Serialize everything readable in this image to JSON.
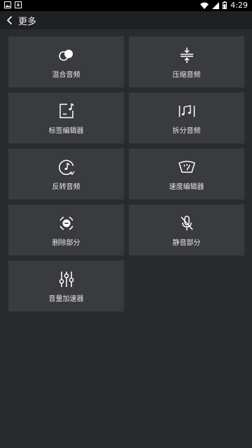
{
  "status_bar": {
    "time": "4:29",
    "icons": [
      "image-notification-icon",
      "download-notification-icon",
      "wifi-icon",
      "signal-icon",
      "battery-icon"
    ]
  },
  "header": {
    "back_icon": "chevron-left-icon",
    "title": "更多"
  },
  "tools": [
    {
      "label": "混合音频",
      "icon": "mix-audio-icon"
    },
    {
      "label": "压缩音频",
      "icon": "compress-audio-icon"
    },
    {
      "label": "标签编辑器",
      "icon": "tag-editor-icon"
    },
    {
      "label": "拆分音频",
      "icon": "split-audio-icon"
    },
    {
      "label": "反转音频",
      "icon": "reverse-audio-icon"
    },
    {
      "label": "速度编辑器",
      "icon": "speed-editor-icon"
    },
    {
      "label": "删除部分",
      "icon": "delete-part-icon"
    },
    {
      "label": "静音部分",
      "icon": "mute-part-icon"
    },
    {
      "label": "音量加速器",
      "icon": "volume-booster-icon"
    }
  ],
  "colors": {
    "background": "#2a2b2e",
    "tile": "#3a3b3f",
    "app_bar": "#1f2023",
    "status_bar": "#000000",
    "icon": "#ffffff"
  }
}
